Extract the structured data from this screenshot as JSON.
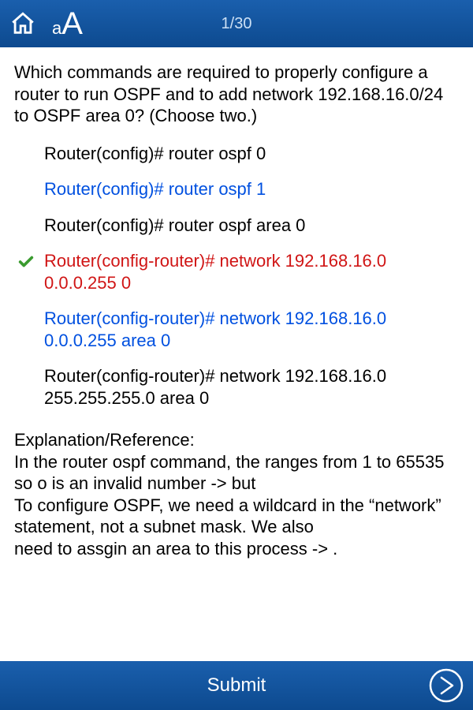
{
  "header": {
    "counter": "1/30"
  },
  "question": "Which commands are required to properly configure a router to run OSPF and to add network 192.168.16.0/24 to OSPF area 0? (Choose two.)",
  "choices": [
    {
      "text": "Router(config)# router ospf 0",
      "style": "normal",
      "checked": false
    },
    {
      "text": "Router(config)# router ospf 1",
      "style": "blue",
      "checked": false
    },
    {
      "text": "Router(config)# router ospf area 0",
      "style": "normal",
      "checked": false
    },
    {
      "text": "Router(config-router)# network 192.168.16.0 0.0.0.255 0",
      "style": "red",
      "checked": true
    },
    {
      "text": "Router(config-router)# network 192.168.16.0 0.0.0.255 area 0",
      "style": "blue",
      "checked": false
    },
    {
      "text": "Router(config-router)# network 192.168.16.0 255.255.255.0 area 0",
      "style": "normal",
      "checked": false
    }
  ],
  "explanation_title": "Explanation/Reference:",
  "explanation_body": "In the router ospf command, the ranges from 1 to 65535 so o is an invalid number -> but\nTo configure OSPF, we need a wildcard in the “network” statement, not a subnet mask. We also\nneed to assgin an area to this process -> .",
  "footer": {
    "submit": "Submit"
  }
}
